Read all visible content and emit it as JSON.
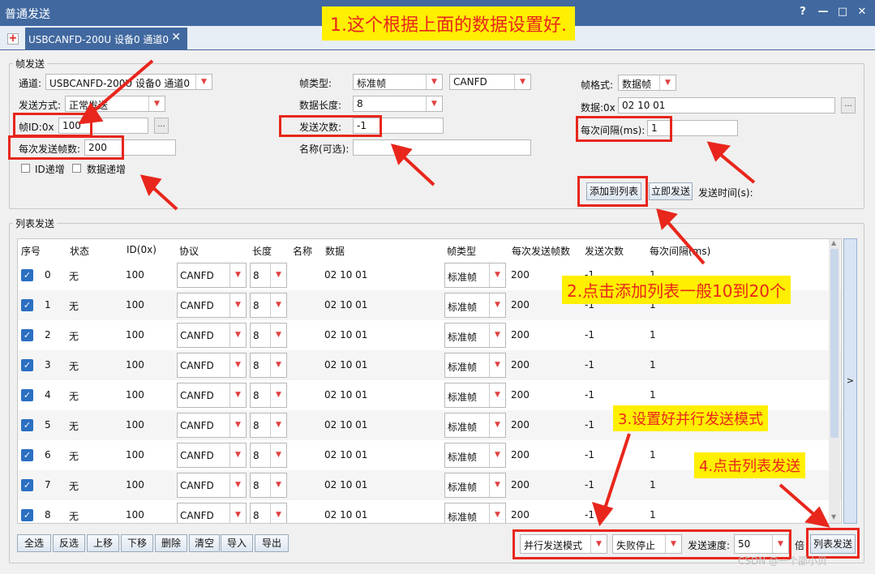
{
  "window": {
    "title": "普通发送",
    "help": "?",
    "minimize": "—",
    "maximize": "□",
    "close": "✕"
  },
  "tabs": [
    {
      "label": "USBCANFD-200U 设备0 通道0",
      "close": "✕"
    }
  ],
  "frame_send": {
    "legend": "帧发送",
    "channel_label": "通道:",
    "channel_value": "USBCANFD-200U 设备0 通道0",
    "send_mode_label": "发送方式:",
    "send_mode_value": "正常发送",
    "frame_id_label": "帧ID:0x",
    "frame_id_value": "100",
    "frame_id_more": "...",
    "frames_per_send_label": "每次发送帧数:",
    "frames_per_send_value": "200",
    "id_increment_label": "ID递增",
    "data_increment_label": "数据递增",
    "frame_type_label": "帧类型:",
    "frame_type_value": "标准帧",
    "protocol_value": "CANFD",
    "data_length_label": "数据长度:",
    "data_length_value": "8",
    "send_count_label": "发送次数:",
    "send_count_value": "-1",
    "name_label": "名称(可选):",
    "name_value": "",
    "frame_format_label": "帧格式:",
    "frame_format_value": "数据帧",
    "data_label": "数据:0x",
    "data_value": "02 10 01",
    "data_more": "...",
    "interval_label": "每次间隔(ms):",
    "interval_value": "1",
    "add_to_list": "添加到列表",
    "send_now": "立即发送",
    "send_time_label": "发送时间(s):"
  },
  "list_send": {
    "legend": "列表发送",
    "headers": [
      "序号",
      "状态",
      "ID(0x)",
      "协议",
      "长度",
      "名称",
      "数据",
      "帧类型",
      "每次发送帧数",
      "发送次数",
      "每次间隔(ms)"
    ],
    "rows": [
      {
        "idx": "0",
        "status": "无",
        "id": "100",
        "protocol": "CANFD",
        "length": "8",
        "name": "",
        "data": "02 10 01",
        "frame_type": "标准帧",
        "frames": "200",
        "count": "-1",
        "interval": "1"
      },
      {
        "idx": "1",
        "status": "无",
        "id": "100",
        "protocol": "CANFD",
        "length": "8",
        "name": "",
        "data": "02 10 01",
        "frame_type": "标准帧",
        "frames": "200",
        "count": "-1",
        "interval": "1"
      },
      {
        "idx": "2",
        "status": "无",
        "id": "100",
        "protocol": "CANFD",
        "length": "8",
        "name": "",
        "data": "02 10 01",
        "frame_type": "标准帧",
        "frames": "200",
        "count": "-1",
        "interval": "1"
      },
      {
        "idx": "3",
        "status": "无",
        "id": "100",
        "protocol": "CANFD",
        "length": "8",
        "name": "",
        "data": "02 10 01",
        "frame_type": "标准帧",
        "frames": "200",
        "count": "-1",
        "interval": "1"
      },
      {
        "idx": "4",
        "status": "无",
        "id": "100",
        "protocol": "CANFD",
        "length": "8",
        "name": "",
        "data": "02 10 01",
        "frame_type": "标准帧",
        "frames": "200",
        "count": "-1",
        "interval": "1"
      },
      {
        "idx": "5",
        "status": "无",
        "id": "100",
        "protocol": "CANFD",
        "length": "8",
        "name": "",
        "data": "02 10 01",
        "frame_type": "标准帧",
        "frames": "200",
        "count": "-1",
        "interval": "1"
      },
      {
        "idx": "6",
        "status": "无",
        "id": "100",
        "protocol": "CANFD",
        "length": "8",
        "name": "",
        "data": "02 10 01",
        "frame_type": "标准帧",
        "frames": "200",
        "count": "-1",
        "interval": "1"
      },
      {
        "idx": "7",
        "status": "无",
        "id": "100",
        "protocol": "CANFD",
        "length": "8",
        "name": "",
        "data": "02 10 01",
        "frame_type": "标准帧",
        "frames": "200",
        "count": "-1",
        "interval": "1"
      },
      {
        "idx": "8",
        "status": "无",
        "id": "100",
        "protocol": "CANFD",
        "length": "8",
        "name": "",
        "data": "02 10 01",
        "frame_type": "标准帧",
        "frames": "200",
        "count": "-1",
        "interval": "1"
      }
    ],
    "side_toggle": ">",
    "buttons": [
      "全选",
      "反选",
      "上移",
      "下移",
      "删除",
      "清空",
      "导入",
      "导出"
    ],
    "mode_value": "并行发送模式",
    "fail_value": "失败停止",
    "speed_label": "发送速度:",
    "speed_value": "50",
    "speed_unit": "倍",
    "list_send_button": "列表发送"
  },
  "annotations": {
    "a1": "1.这个根据上面的数据设置好.",
    "a2": "2.点击添加列表一般10到20个",
    "a3": "3.设置好并行发送模式",
    "a4": "4.点击列表发送"
  },
  "watermark": "CSDN @一个邵小贝",
  "colors": {
    "titlebar": "#4169a0",
    "annotation_bg": "#ffef00",
    "annotation_text": "#e8261c",
    "checkbox": "#2b6fc2"
  }
}
